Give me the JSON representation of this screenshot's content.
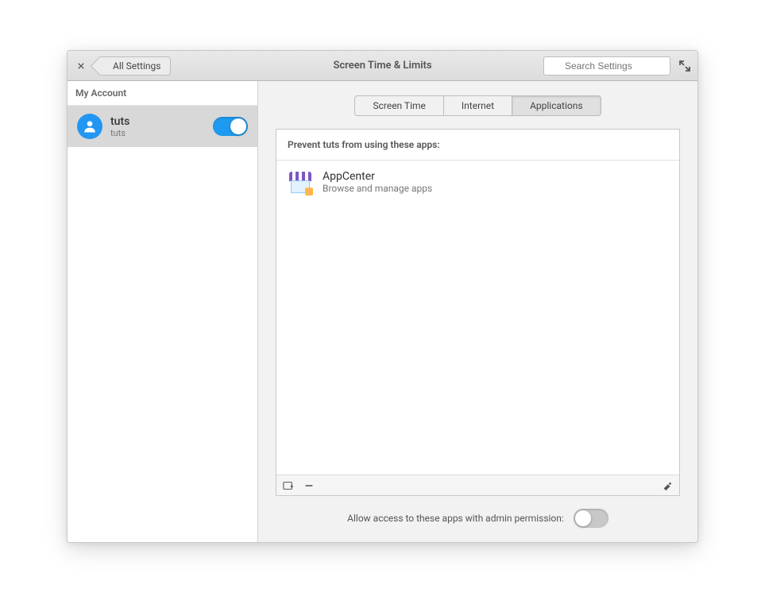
{
  "header": {
    "title": "Screen Time & Limits",
    "back_label": "All Settings",
    "search_placeholder": "Search Settings"
  },
  "sidebar": {
    "heading": "My Account",
    "account": {
      "name": "tuts",
      "subtitle": "tuts",
      "enabled": true
    }
  },
  "tabs": [
    {
      "label": "Screen Time",
      "active": false
    },
    {
      "label": "Internet",
      "active": false
    },
    {
      "label": "Applications",
      "active": true
    }
  ],
  "panel": {
    "header": "Prevent tuts from using these apps:",
    "apps": [
      {
        "name": "AppCenter",
        "description": "Browse and manage apps"
      }
    ]
  },
  "footer": {
    "allow_label": "Allow access to these apps with admin permission:",
    "allow_enabled": false
  }
}
